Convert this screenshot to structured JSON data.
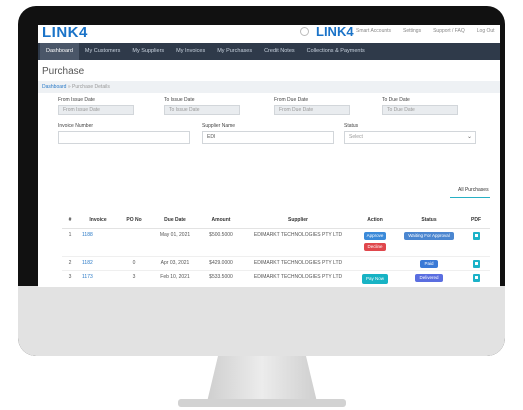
{
  "header": {
    "logo": "LINK4",
    "logo_right": "LINK4",
    "top_links": [
      "Smart Accounts",
      "Settings",
      "Support / FAQ",
      "Log Out"
    ]
  },
  "nav": {
    "items": [
      "Dashboard",
      "My Customers",
      "My Suppliers",
      "My Invoices",
      "My Purchases",
      "Credit Notes",
      "Collections & Payments"
    ],
    "active": "Dashboard"
  },
  "page": {
    "title": "Purchase",
    "breadcrumb_home": "Dashboard",
    "breadcrumb_current": "» Purchase Details"
  },
  "filters": {
    "from_issue_label": "From Issue Date",
    "from_issue_placeholder": "From Issue Date",
    "to_issue_label": "To Issue Date",
    "to_issue_placeholder": "To Issue Date",
    "from_due_label": "From Due Date",
    "from_due_placeholder": "From Due Date",
    "to_due_label": "To Due Date",
    "to_due_placeholder": "To Due Date",
    "invoice_number_label": "Invoice Number",
    "invoice_number_value": "",
    "supplier_label": "Supplier Name",
    "supplier_value": "EDI",
    "status_label": "Status",
    "status_value": "Select"
  },
  "tabs": {
    "all_purchases": "All Purchases"
  },
  "table": {
    "headers": [
      "#",
      "Invoice",
      "PO No",
      "Due Date",
      "Amount",
      "Supplier",
      "Action",
      "Status",
      "PDF"
    ],
    "rows": [
      {
        "num": "1",
        "invoice": "1188",
        "po": "",
        "due": "May 01, 2021",
        "amount": "$500.5000",
        "supplier": "EDIMARKT TECHNOLOGIES PTY LTD",
        "actions": [
          "Approve",
          "Decline"
        ],
        "status": "Waiting For Approval"
      },
      {
        "num": "2",
        "invoice": "1182",
        "po": "0",
        "due": "Apr 03, 2021",
        "amount": "$429.0000",
        "supplier": "EDIMARKT TECHNOLOGIES PTY LTD",
        "actions": [],
        "status": "Paid"
      },
      {
        "num": "3",
        "invoice": "1173",
        "po": "3",
        "due": "Feb 10, 2021",
        "amount": "$533.5000",
        "supplier": "EDIMARKT TECHNOLOGIES PTY LTD",
        "actions": [
          "Pay Now"
        ],
        "status": "Delivered"
      }
    ]
  },
  "colors": {
    "nav_bg": "#2f3a4a",
    "brand": "#1a73c8",
    "accent": "#17b3c4",
    "decline": "#e0474c"
  }
}
